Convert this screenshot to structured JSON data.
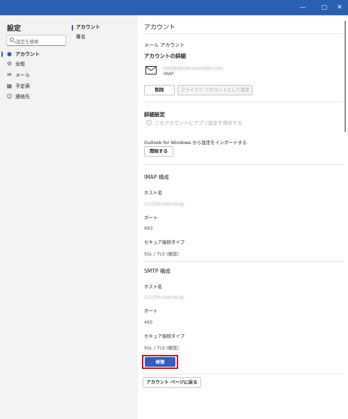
{
  "window": {
    "controls": {
      "minimize": "—",
      "maximize": "▢",
      "close": "✕"
    }
  },
  "sidebar": {
    "title": "設定",
    "search_placeholder": "設定を検索",
    "items": [
      {
        "label": "アカウント",
        "icon": "person-icon"
      },
      {
        "label": "全般",
        "icon": "gear-icon"
      },
      {
        "label": "メール",
        "icon": "mail-icon"
      },
      {
        "label": "予定表",
        "icon": "calendar-icon"
      },
      {
        "label": "連絡先",
        "icon": "people-icon"
      }
    ]
  },
  "subnav": {
    "items": [
      {
        "label": "アカウント"
      },
      {
        "label": "署名"
      }
    ]
  },
  "main": {
    "title": "アカウント",
    "mail_account_label": "メール アカウント",
    "details_heading": "アカウントの詳細",
    "account_email": "test@server-example.com",
    "account_type": "IMAP",
    "remove_button": "削除",
    "primary_button": "プライマリ アカウントとして設定",
    "advanced_heading": "詳細設定",
    "save_settings_label": "このアカウントにアプリ設定を保存する",
    "import_label": "Outlook for Windows から設定をインポートする",
    "start_button": "開始する",
    "imap": {
      "heading": "IMAP 構成",
      "host_label": "ホスト名",
      "host_value": "sv1234.xserver.jp",
      "port_label": "ポート",
      "port_value": "993",
      "security_label": "セキュア接続タイプ",
      "security_value": "SSL / TLS (推奨)"
    },
    "smtp": {
      "heading": "SMTP 構成",
      "host_label": "ホスト名",
      "host_value": "sv1234.xserver.jp",
      "port_label": "ポート",
      "port_value": "465",
      "security_label": "セキュア接続タイプ",
      "security_value": "SSL / TLS (推奨)"
    },
    "modify_button": "修復",
    "back_button": "アカウント ページに戻る"
  },
  "colors": {
    "titlebar": "#2b5fb4",
    "primary_button": "#2f5fbf",
    "highlight": "#d9001b"
  }
}
